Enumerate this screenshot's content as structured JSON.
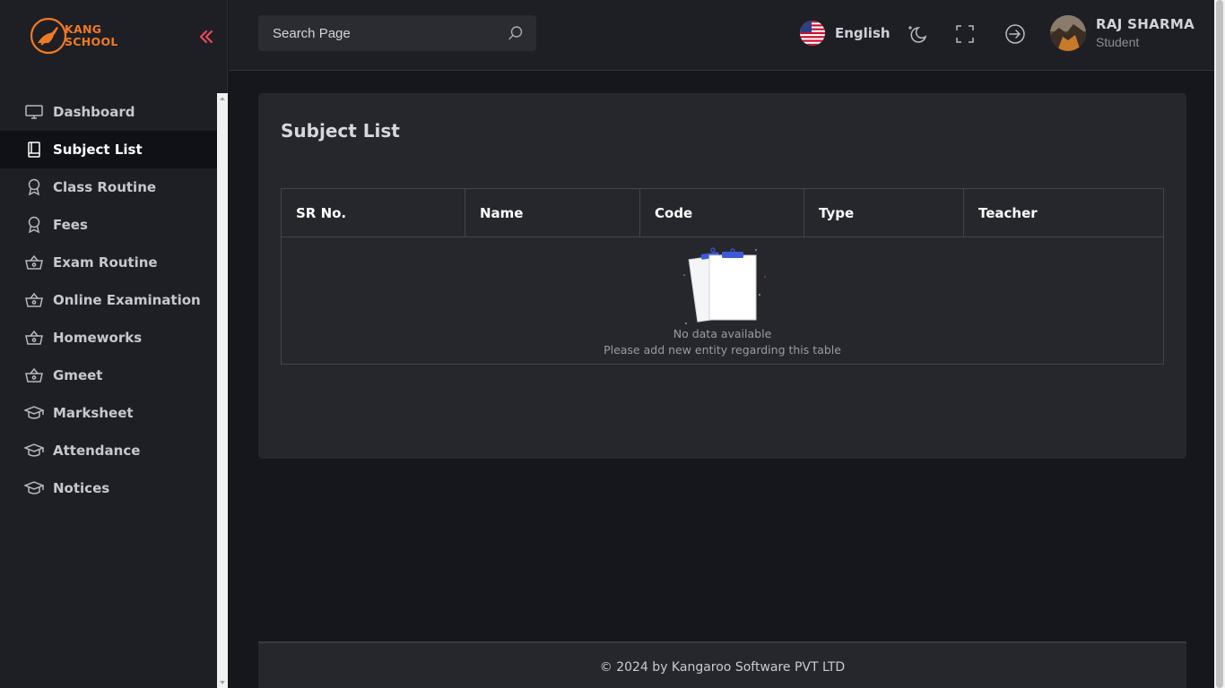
{
  "brand": {
    "line1": "KANG",
    "line2": "SCHOOL",
    "accent": "#f07a24"
  },
  "sidebar": {
    "items": [
      {
        "label": "Dashboard",
        "icon": "monitor-icon",
        "active": false
      },
      {
        "label": "Subject List",
        "icon": "book-icon",
        "active": true
      },
      {
        "label": "Class Routine",
        "icon": "award-icon",
        "active": false
      },
      {
        "label": "Fees",
        "icon": "award-icon",
        "active": false
      },
      {
        "label": "Exam Routine",
        "icon": "basket-icon",
        "active": false
      },
      {
        "label": "Online Examination",
        "icon": "basket-icon",
        "active": false
      },
      {
        "label": "Homeworks",
        "icon": "basket-icon",
        "active": false
      },
      {
        "label": "Gmeet",
        "icon": "basket-icon",
        "active": false
      },
      {
        "label": "Marksheet",
        "icon": "graduation-cap-icon",
        "active": false
      },
      {
        "label": "Attendance",
        "icon": "graduation-cap-icon",
        "active": false
      },
      {
        "label": "Notices",
        "icon": "graduation-cap-icon",
        "active": false
      }
    ]
  },
  "header": {
    "search_placeholder": "Search Page",
    "language": "English",
    "user": {
      "name": "RAJ SHARMA",
      "role": "Student"
    }
  },
  "main": {
    "title": "Subject List",
    "table": {
      "columns": [
        "SR No.",
        "Name",
        "Code",
        "Type",
        "Teacher"
      ],
      "rows": [],
      "empty_title": "No data available",
      "empty_sub": "Please add new entity regarding this table"
    }
  },
  "footer": {
    "text": "© 2024 by Kangaroo Software PVT LTD"
  }
}
